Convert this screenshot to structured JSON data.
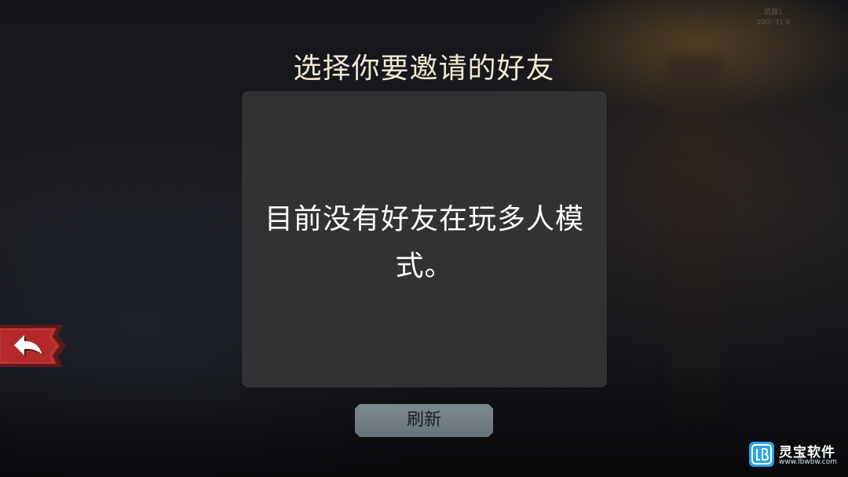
{
  "screen": {
    "title": "选择你要邀请的好友",
    "empty_message": "目前没有好友在玩多人模式。",
    "refresh_label": "刷新",
    "back_icon": "back-arrow-icon"
  },
  "background": {
    "corner_text_line1": "武器1",
    "corner_text_line2": "200/ 31 K"
  },
  "watermark": {
    "name": "灵宝软件",
    "url": "www.lbwbw.com",
    "logo_icon": "lb-logo-icon"
  },
  "colors": {
    "panel": "#343436",
    "title_text": "#f1e8d2",
    "button_fill": "#75828a",
    "back_banner": "#b4292a",
    "back_banner_border": "#5b1a1a"
  }
}
